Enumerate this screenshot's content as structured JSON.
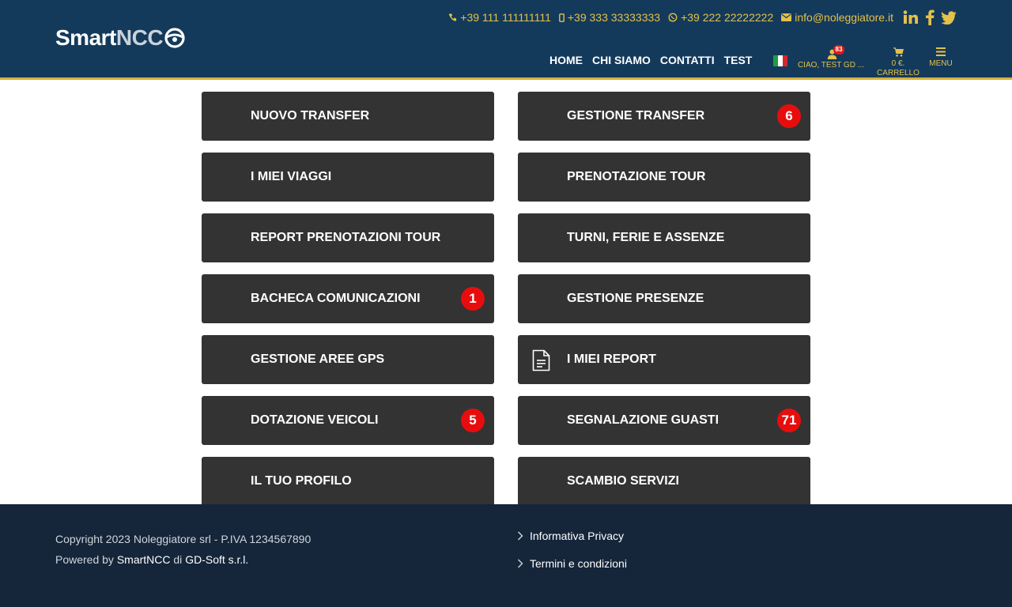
{
  "header": {
    "logo": {
      "part1": "Smart",
      "part2": "NCC"
    },
    "contacts": [
      {
        "icon": "phone-icon",
        "text": "+39 111 111111111"
      },
      {
        "icon": "mobile-icon",
        "text": "+39 333 33333333"
      },
      {
        "icon": "whatsapp-icon",
        "text": "+39 222 22222222"
      },
      {
        "icon": "envelope-icon",
        "text": "info@noleggiatore.it"
      }
    ],
    "social": [
      "linkedin-icon",
      "facebook-icon",
      "twitter-icon"
    ],
    "nav": [
      "HOME",
      "CHI SIAMO",
      "CONTATTI",
      "TEST"
    ],
    "language": "it",
    "user": {
      "notifications": "83",
      "greeting": "CIAO, TEST GD ..."
    },
    "cart": {
      "amount": "0 €.",
      "label": "CARRELLO"
    },
    "menu_label": "MENU"
  },
  "tiles": [
    {
      "label": "NUOVO TRANSFER",
      "badge": ""
    },
    {
      "label": "GESTIONE TRANSFER",
      "badge": "6"
    },
    {
      "label": "I MIEI VIAGGI",
      "badge": ""
    },
    {
      "label": "PRENOTAZIONE TOUR",
      "badge": ""
    },
    {
      "label": "REPORT PRENOTAZIONI TOUR",
      "badge": ""
    },
    {
      "label": "TURNI, FERIE E ASSENZE",
      "badge": ""
    },
    {
      "label": "BACHECA COMUNICAZIONI",
      "badge": "1"
    },
    {
      "label": "GESTIONE PRESENZE",
      "badge": ""
    },
    {
      "label": "GESTIONE AREE GPS",
      "badge": ""
    },
    {
      "label": "I MIEI REPORT",
      "badge": "",
      "icon": "document-icon"
    },
    {
      "label": "DOTAZIONE VEICOLI",
      "badge": "5"
    },
    {
      "label": "SEGNALAZIONE GUASTI",
      "badge": "71"
    },
    {
      "label": "IL TUO PROFILO",
      "badge": ""
    },
    {
      "label": "SCAMBIO SERVIZI",
      "badge": ""
    }
  ],
  "footer": {
    "copyright": "Copyright 2023 Noleggiatore srl - P.IVA 1234567890",
    "powered_prefix": "Powered by",
    "powered_brand": "SmartNCC",
    "powered_mid": "di",
    "powered_company": "GD-Soft s.r.l.",
    "links": [
      "Informativa Privacy",
      "Termini e condizioni"
    ]
  },
  "colors": {
    "header_bg": "#143a5b",
    "accent": "#d6b23a",
    "tile_bg": "#333333",
    "badge": "#e80d0d",
    "footer_bg": "#15253a"
  }
}
